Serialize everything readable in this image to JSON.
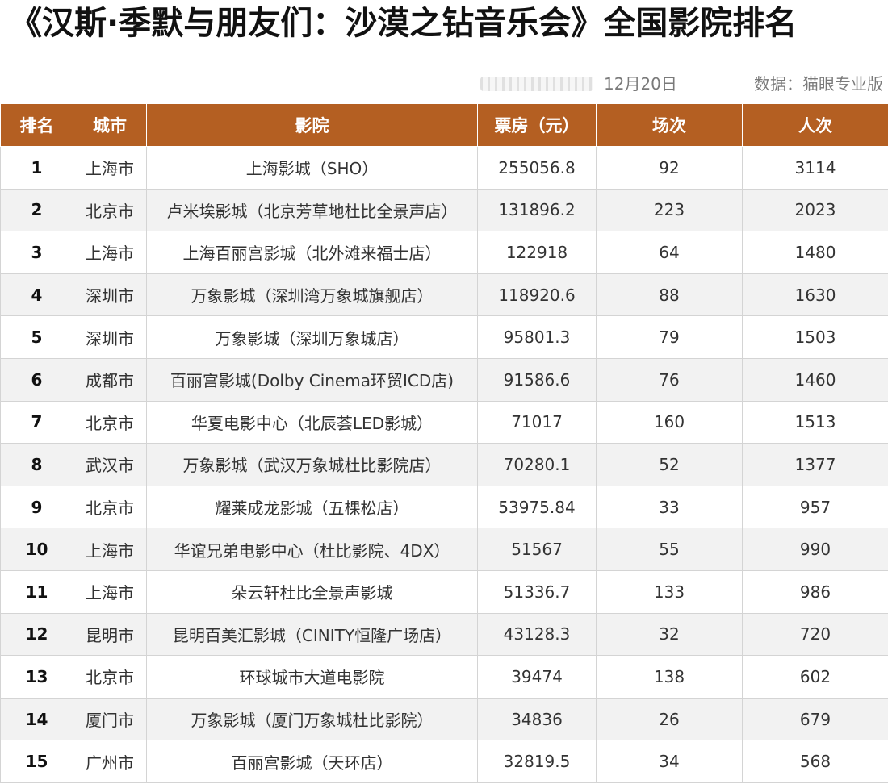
{
  "title": "《汉斯·季默与朋友们：沙漠之钻音乐会》全国影院排名",
  "meta": {
    "date": "12月20日",
    "source": "数据：猫眼专业版"
  },
  "table": {
    "headers": [
      "排名",
      "城市",
      "影院",
      "票房（元）",
      "场次",
      "人次"
    ],
    "rows": [
      {
        "rank": "1",
        "city": "上海市",
        "cinema": "上海影城（SHO）",
        "box_office": "255056.8",
        "shows": "92",
        "admissions": "3114"
      },
      {
        "rank": "2",
        "city": "北京市",
        "cinema": "卢米埃影城（北京芳草地杜比全景声店）",
        "box_office": "131896.2",
        "shows": "223",
        "admissions": "2023"
      },
      {
        "rank": "3",
        "city": "上海市",
        "cinema": "上海百丽宫影城（北外滩来福士店）",
        "box_office": "122918",
        "shows": "64",
        "admissions": "1480"
      },
      {
        "rank": "4",
        "city": "深圳市",
        "cinema": "万象影城（深圳湾万象城旗舰店）",
        "box_office": "118920.6",
        "shows": "88",
        "admissions": "1630"
      },
      {
        "rank": "5",
        "city": "深圳市",
        "cinema": "万象影城（深圳万象城店）",
        "box_office": "95801.3",
        "shows": "79",
        "admissions": "1503"
      },
      {
        "rank": "6",
        "city": "成都市",
        "cinema": "百丽宫影城(Dolby Cinema环贸ICD店)",
        "box_office": "91586.6",
        "shows": "76",
        "admissions": "1460"
      },
      {
        "rank": "7",
        "city": "北京市",
        "cinema": "华夏电影中心（北辰荟LED影城）",
        "box_office": "71017",
        "shows": "160",
        "admissions": "1513"
      },
      {
        "rank": "8",
        "city": "武汉市",
        "cinema": "万象影城（武汉万象城杜比影院店）",
        "box_office": "70280.1",
        "shows": "52",
        "admissions": "1377"
      },
      {
        "rank": "9",
        "city": "北京市",
        "cinema": "耀莱成龙影城（五棵松店）",
        "box_office": "53975.84",
        "shows": "33",
        "admissions": "957"
      },
      {
        "rank": "10",
        "city": "上海市",
        "cinema": "华谊兄弟电影中心（杜比影院、4DX）",
        "box_office": "51567",
        "shows": "55",
        "admissions": "990"
      },
      {
        "rank": "11",
        "city": "上海市",
        "cinema": "朵云轩杜比全景声影城",
        "box_office": "51336.7",
        "shows": "133",
        "admissions": "986"
      },
      {
        "rank": "12",
        "city": "昆明市",
        "cinema": "昆明百美汇影城（CINITY恒隆广场店）",
        "box_office": "43128.3",
        "shows": "32",
        "admissions": "720"
      },
      {
        "rank": "13",
        "city": "北京市",
        "cinema": "环球城市大道电影院",
        "box_office": "39474",
        "shows": "138",
        "admissions": "602"
      },
      {
        "rank": "14",
        "city": "厦门市",
        "cinema": "万象影城（厦门万象城杜比影院）",
        "box_office": "34836",
        "shows": "26",
        "admissions": "679"
      },
      {
        "rank": "15",
        "city": "广州市",
        "cinema": "百丽宫影城（天环店）",
        "box_office": "32819.5",
        "shows": "34",
        "admissions": "568"
      }
    ]
  },
  "colors": {
    "header_bg": "#b45f22",
    "header_text": "#ffffff",
    "row_alt_bg": "#f2f2f2"
  }
}
